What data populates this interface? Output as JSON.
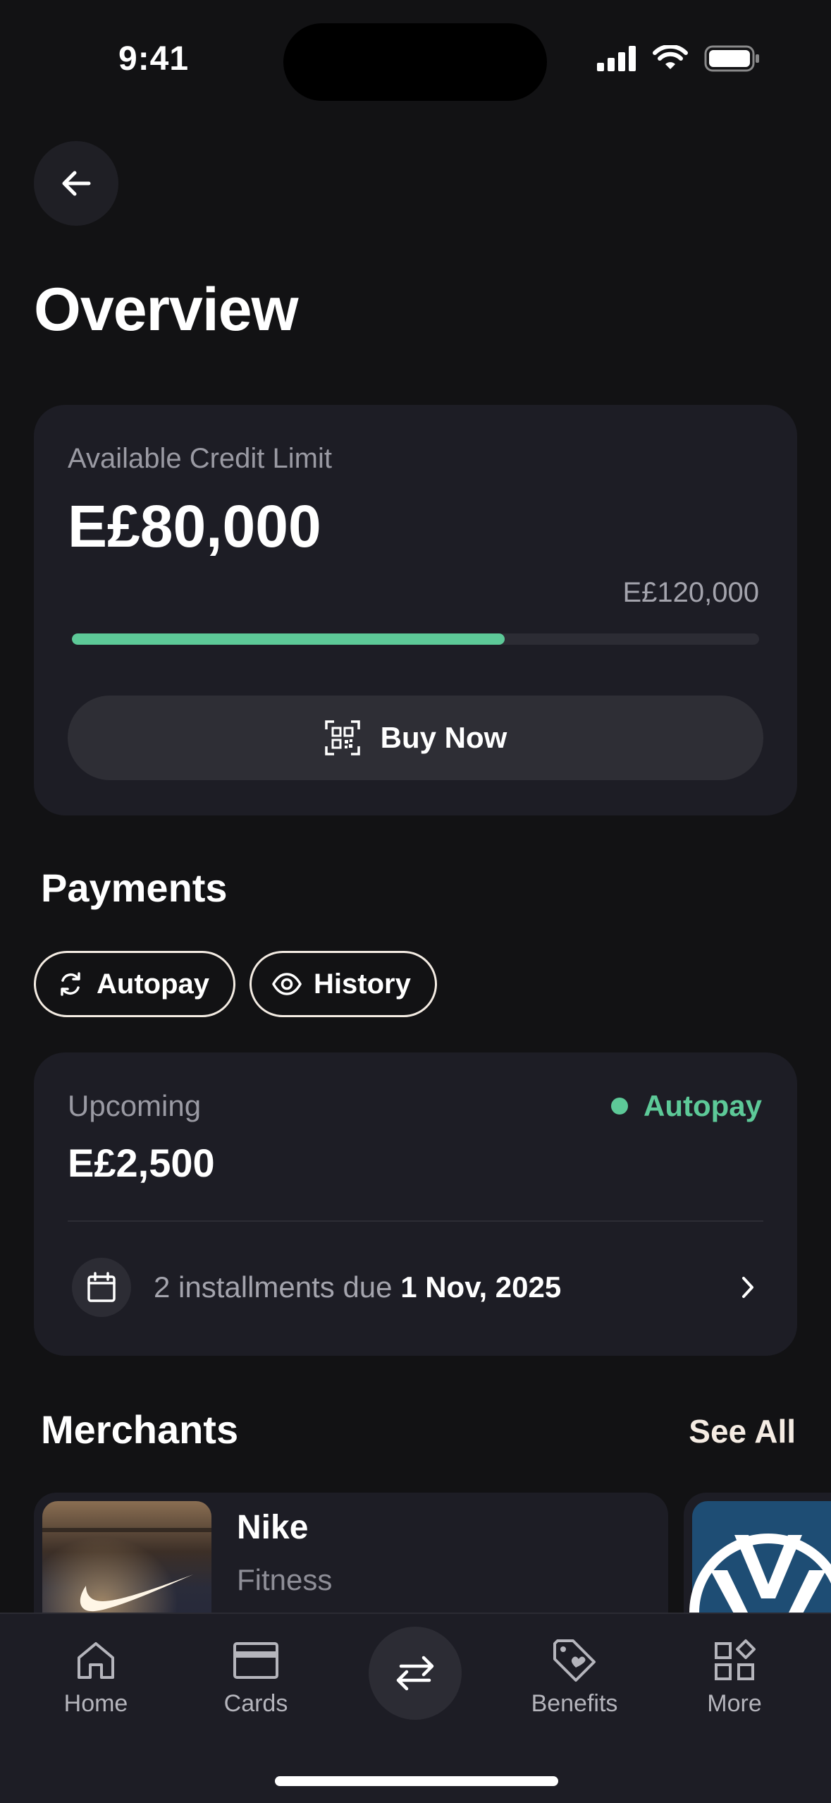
{
  "status_bar": {
    "time": "9:41"
  },
  "page": {
    "title": "Overview"
  },
  "credit": {
    "label": "Available Credit Limit",
    "available": "E£80,000",
    "total": "E£120,000",
    "used_fraction": 0.63,
    "accent": "#5dc998"
  },
  "buy_now": {
    "label": "Buy Now",
    "icon": "qr-scan-icon"
  },
  "payments": {
    "title": "Payments",
    "chips": [
      {
        "label": "Autopay",
        "icon": "refresh-icon"
      },
      {
        "label": "History",
        "icon": "eye-icon"
      }
    ],
    "upcoming": {
      "label": "Upcoming",
      "amount": "E£2,500",
      "status": "Autopay",
      "installments_text": "2 installments due",
      "due_date": "1 Nov, 2025"
    }
  },
  "merchants": {
    "title": "Merchants",
    "see_all": "See All",
    "items": [
      {
        "name": "Nike",
        "category": "Fitness"
      }
    ]
  },
  "tab_bar": {
    "items": [
      {
        "label": "Home",
        "icon": "home-icon"
      },
      {
        "label": "Cards",
        "icon": "card-icon"
      },
      {
        "label": "",
        "icon": "transfer-icon"
      },
      {
        "label": "Benefits",
        "icon": "tag-icon"
      },
      {
        "label": "More",
        "icon": "grid-icon"
      }
    ]
  }
}
